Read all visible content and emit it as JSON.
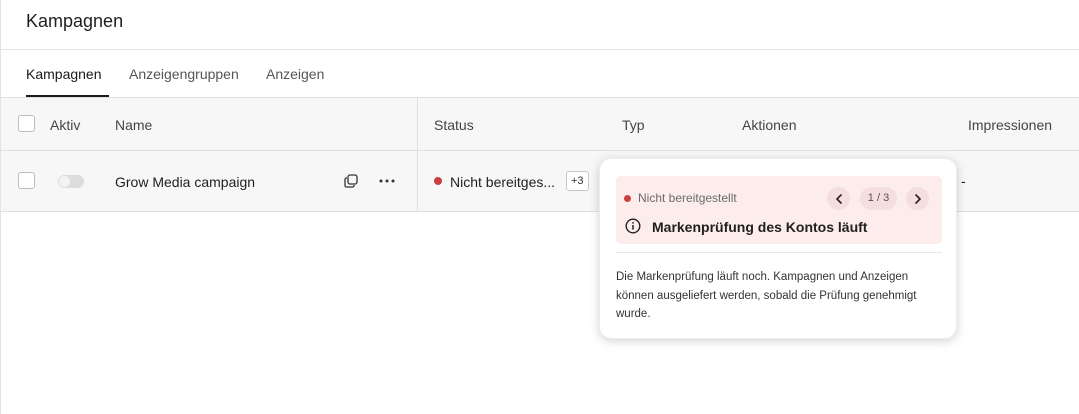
{
  "page": {
    "title": "Kampagnen"
  },
  "tabs": [
    {
      "label": "Kampagnen",
      "active": true
    },
    {
      "label": "Anzeigengruppen",
      "active": false
    },
    {
      "label": "Anzeigen",
      "active": false
    }
  ],
  "table": {
    "columns": [
      "Aktiv",
      "Name",
      "Status",
      "Typ",
      "Aktionen",
      "Impressionen"
    ],
    "rows": [
      {
        "active": false,
        "name": "Grow Media campaign",
        "status": "Nicht bereitges...",
        "status_more": "+3",
        "impressions": "-",
        "icons": [
          "duplicate-icon",
          "more-icon"
        ]
      }
    ]
  },
  "popover": {
    "status": "Nicht bereitgestellt",
    "pager": "1 / 3",
    "title": "Markenprüfung des Kontos läuft",
    "body": "Die Markenprüfung läuft noch. Kampagnen und Anzeigen können ausgeliefert werden, sobald die Prüfung genehmigt wurde."
  },
  "colors": {
    "status_error": "#c9403f",
    "alert_background": "#fcecec",
    "header_background": "#f7f7f7",
    "active_tab": "#1a1a1a"
  }
}
